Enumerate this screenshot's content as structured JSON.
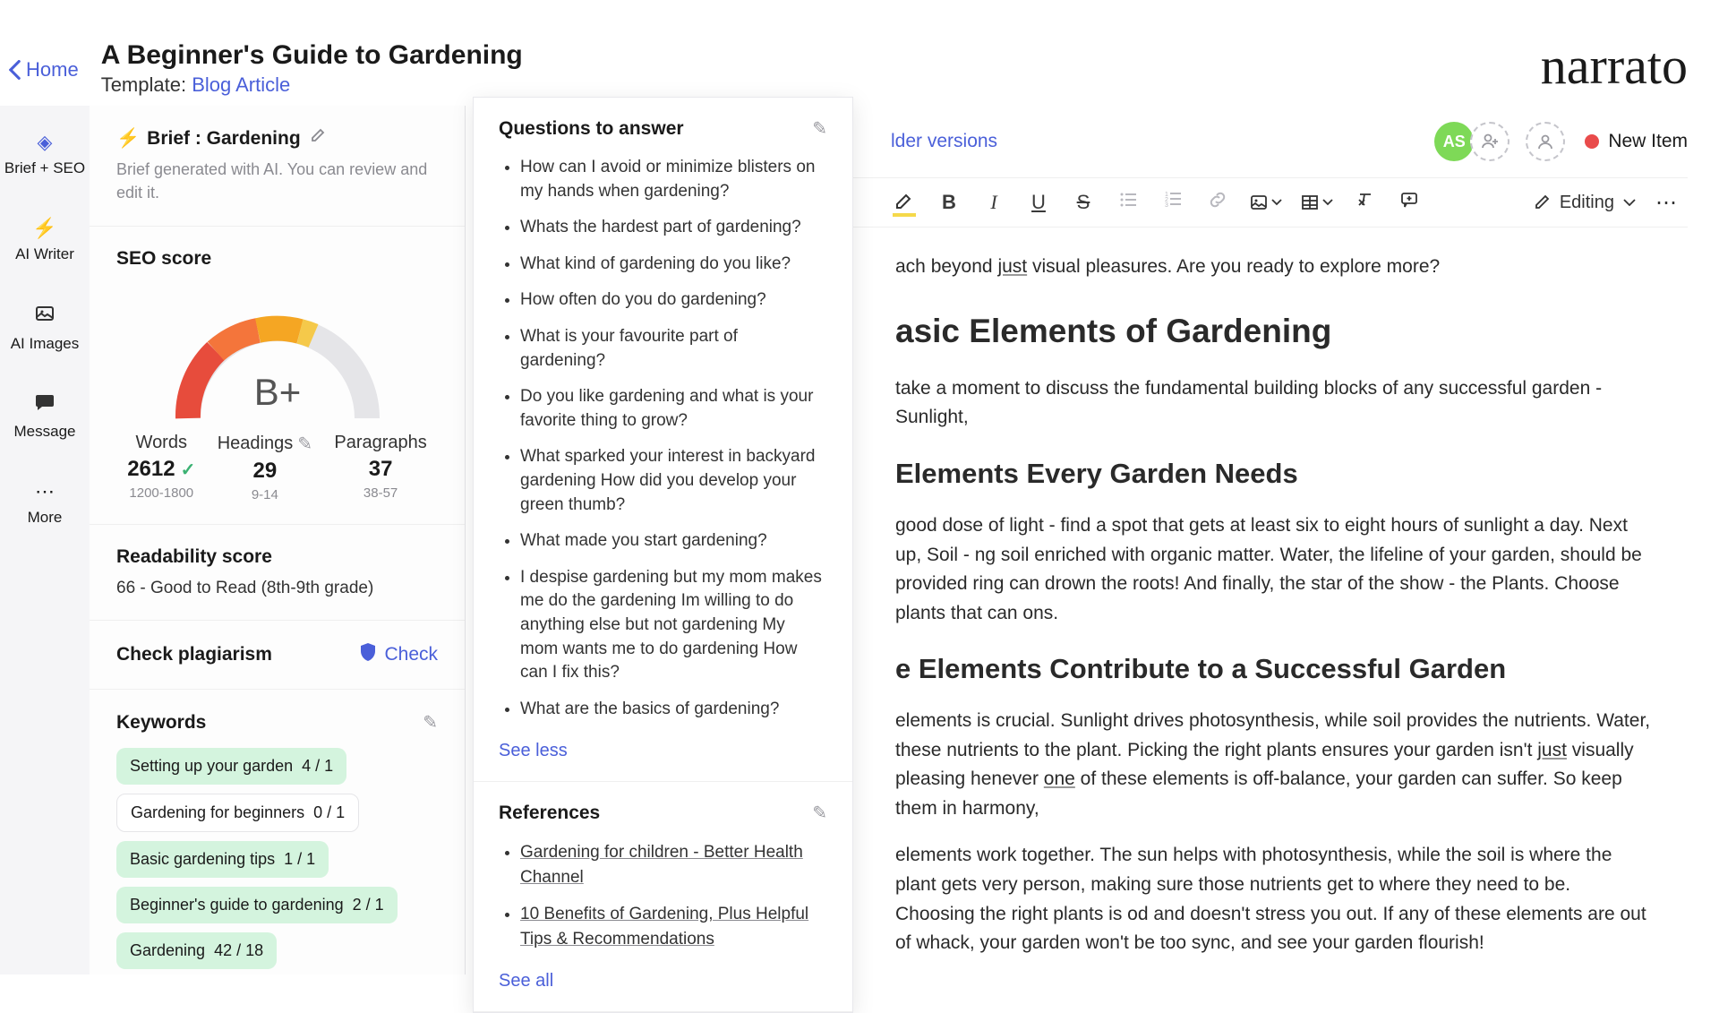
{
  "header": {
    "home_label": "Home",
    "page_title": "A Beginner's Guide to Gardening",
    "template_prefix": "Template: ",
    "template_name": "Blog Article",
    "logo": "narrato"
  },
  "rail": {
    "items": [
      {
        "label": "Brief + SEO",
        "icon": "✦"
      },
      {
        "label": "AI Writer",
        "icon": "⚡"
      },
      {
        "label": "AI Images",
        "icon": "🖼"
      },
      {
        "label": "Message",
        "icon": "💬"
      },
      {
        "label": "More",
        "icon": "⋯"
      }
    ]
  },
  "seo_panel": {
    "brief_title": "Brief : Gardening",
    "brief_sub": "Brief generated with AI. You can review and edit it.",
    "seo_score_title": "SEO score",
    "grade": "B+",
    "metrics": {
      "words": {
        "label": "Words",
        "value": "2612",
        "range": "1200-1800",
        "ok": true
      },
      "headings": {
        "label": "Headings",
        "value": "29",
        "range": "9-14"
      },
      "paragraphs": {
        "label": "Paragraphs",
        "value": "37",
        "range": "38-57"
      }
    },
    "readability_title": "Readability score",
    "readability_text": "66 - Good to Read (8th-9th grade)",
    "plagiarism_title": "Check plagiarism",
    "check_label": "Check",
    "keywords_title": "Keywords",
    "keywords": [
      {
        "text": "Setting up your garden",
        "count": "4 / 1",
        "ok": true
      },
      {
        "text": "Gardening for beginners",
        "count": "0 / 1",
        "ok": false
      },
      {
        "text": "Basic gardening tips",
        "count": "1 / 1",
        "ok": true
      },
      {
        "text": "Beginner's guide to gardening",
        "count": "2 / 1",
        "ok": true
      },
      {
        "text": "Gardening",
        "count": "42 / 18",
        "ok": true
      }
    ]
  },
  "questions_panel": {
    "title": "Questions to answer",
    "questions": [
      "How can I avoid or minimize blisters on my hands when gardening?",
      "Whats the hardest part of gardening?",
      "What kind of gardening do you like?",
      "How often do you do gardening?",
      "What is your favourite part of gardening?",
      "Do you like gardening and what is your favorite thing to grow?",
      "What sparked your interest in backyard gardening How did you develop your green thumb?",
      "What made you start gardening?",
      "I despise gardening but my mom makes me do the gardening Im willing to do anything else but not gardening My mom wants me to do gardening How can I fix this?",
      "What are the basics of gardening?"
    ],
    "see_less": "See less",
    "references_title": "References",
    "references": [
      "Gardening for children - Better Health Channel",
      "10 Benefits of Gardening, Plus Helpful Tips & Recommendations"
    ],
    "see_all": "See all"
  },
  "editor": {
    "older_versions": "lder versions",
    "avatar": "AS",
    "status": "New Item",
    "editing_label": "Editing",
    "body": {
      "p1_prefix": "ach beyond ",
      "p1_just": "just",
      "p1_rest": " visual pleasures. Are you ready to explore more?",
      "h2_1": "asic Elements of Gardening",
      "p2": " take a moment to discuss the fundamental building blocks of any successful garden - Sunlight,",
      "h3_1": "Elements Every Garden Needs",
      "p3": "good dose of light - find a spot that gets at least six to eight hours of sunlight a day. Next up, Soil - ng soil enriched with organic matter. Water, the lifeline of your garden, should be provided ring can drown the roots! And finally, the star of the show - the Plants. Choose plants that can ons.",
      "h3_2": "e Elements Contribute to a Successful Garden",
      "p4_a": " elements is crucial. Sunlight drives photosynthesis, while soil provides the nutrients. Water,  these nutrients to the plant. Picking the right plants ensures your garden isn't ",
      "p4_just": "just",
      "p4_b": " visually pleasing henever ",
      "p4_one": "one",
      "p4_c": " of these elements is off-balance, your garden can suffer. So keep them in harmony,",
      "p5": " elements work together. The sun helps with photosynthesis, while the soil is where the plant gets very person, making sure those nutrients get to where they need to be. Choosing the right plants is od and doesn't stress you out. If any of these elements are out of whack, your garden won't be too  sync, and see your garden flourish!"
    }
  }
}
